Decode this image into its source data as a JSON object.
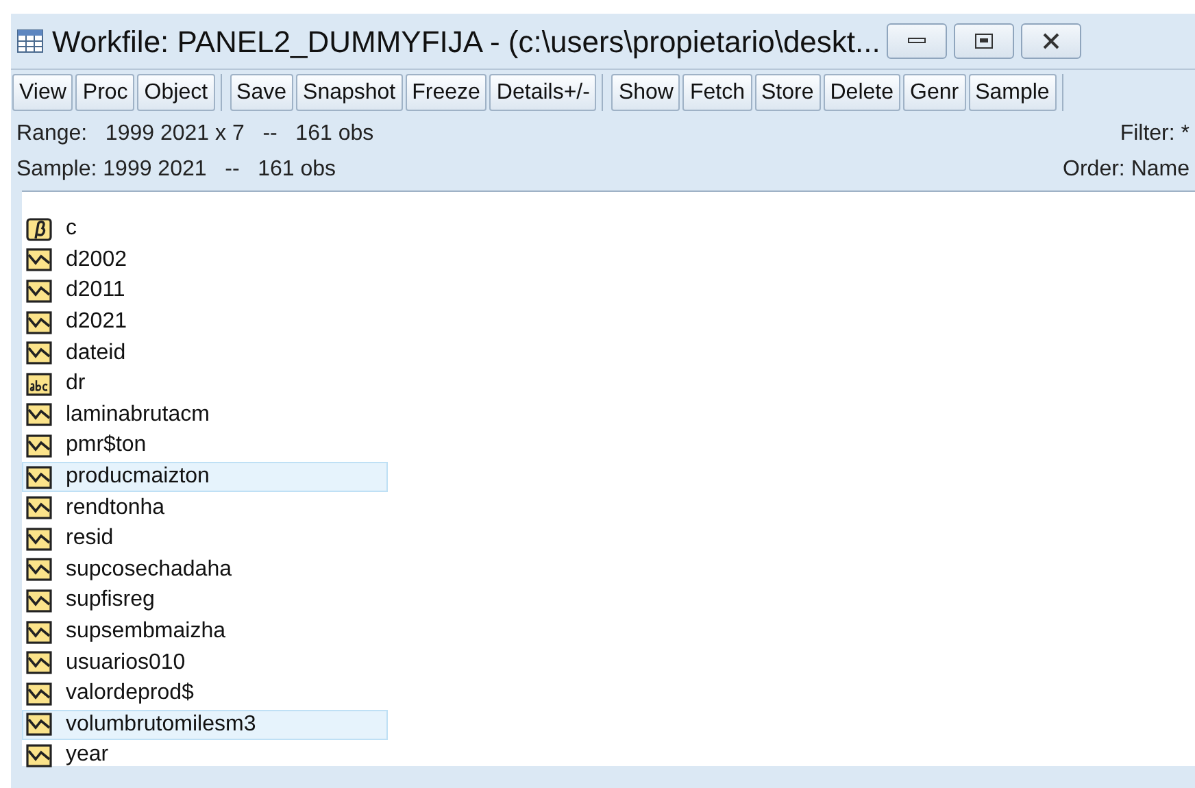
{
  "window": {
    "title": "Workfile: PANEL2_DUMMYFIJA - (c:\\users\\propietario\\deskt..."
  },
  "toolbar": {
    "groups": [
      {
        "buttons": [
          "View",
          "Proc",
          "Object"
        ]
      },
      {
        "buttons": [
          "Save",
          "Snapshot",
          "Freeze",
          "Details+/-"
        ]
      },
      {
        "buttons": [
          "Show",
          "Fetch",
          "Store",
          "Delete",
          "Genr",
          "Sample"
        ]
      }
    ]
  },
  "info": {
    "range_label": "Range:",
    "range": "1999 2021 x 7",
    "range_sep": "--",
    "range_obs": "161 obs",
    "filter": "Filter: *",
    "sample_label": "Sample:",
    "sample": "1999 2021",
    "sample_sep": "--",
    "sample_obs": "161 obs",
    "order": "Order: Name"
  },
  "objects": [
    {
      "kind": "coef",
      "name": "c",
      "selected": false
    },
    {
      "kind": "series",
      "name": "d2002",
      "selected": false
    },
    {
      "kind": "series",
      "name": "d2011",
      "selected": false
    },
    {
      "kind": "series",
      "name": "d2021",
      "selected": false
    },
    {
      "kind": "series",
      "name": "dateid",
      "selected": false
    },
    {
      "kind": "alpha",
      "name": "dr",
      "selected": false
    },
    {
      "kind": "series",
      "name": "laminabrutacm",
      "selected": false
    },
    {
      "kind": "series",
      "name": "pmr$ton",
      "selected": false
    },
    {
      "kind": "series",
      "name": "producmaizton",
      "selected": true
    },
    {
      "kind": "series",
      "name": "rendtonha",
      "selected": false
    },
    {
      "kind": "series",
      "name": "resid",
      "selected": false
    },
    {
      "kind": "series",
      "name": "supcosechadaha",
      "selected": false
    },
    {
      "kind": "series",
      "name": "supfisreg",
      "selected": false
    },
    {
      "kind": "series",
      "name": "supsembmaizha",
      "selected": false
    },
    {
      "kind": "series",
      "name": "usuarios010",
      "selected": false
    },
    {
      "kind": "series",
      "name": "valordeprod$",
      "selected": false
    },
    {
      "kind": "series",
      "name": "volumbrutomilesm3",
      "selected": true
    },
    {
      "kind": "series",
      "name": "year",
      "selected": false
    }
  ]
}
